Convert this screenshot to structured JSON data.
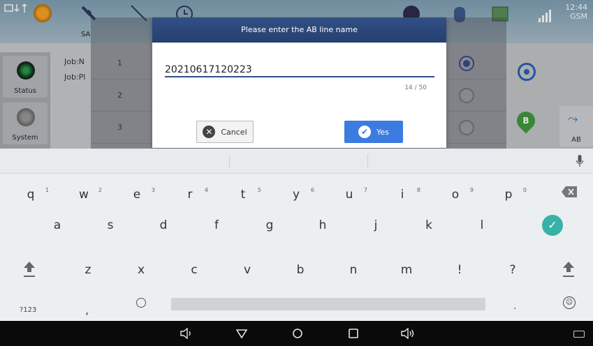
{
  "app": {
    "sat_label": "SA",
    "clock": "12:44",
    "network": "GSM",
    "rail": [
      {
        "label": "Status"
      },
      {
        "label": "System"
      }
    ],
    "job_lines": [
      "Job:N",
      "Job:Pl"
    ],
    "list_rows": [
      {
        "num": "1",
        "selected": true
      },
      {
        "num": "2",
        "selected": false
      },
      {
        "num": "3",
        "selected": false
      }
    ],
    "ab_label": "AB",
    "b_marker": "B"
  },
  "dialog": {
    "title": "Please enter the AB line name",
    "input_value": "20210617120223",
    "char_count": "14 / 50",
    "cancel_label": "Cancel",
    "yes_label": "Yes"
  },
  "keyboard": {
    "row1": [
      {
        "ch": "q",
        "hint": "1"
      },
      {
        "ch": "w",
        "hint": "2"
      },
      {
        "ch": "e",
        "hint": "3"
      },
      {
        "ch": "r",
        "hint": "4"
      },
      {
        "ch": "t",
        "hint": "5"
      },
      {
        "ch": "y",
        "hint": "6"
      },
      {
        "ch": "u",
        "hint": "7"
      },
      {
        "ch": "i",
        "hint": "8"
      },
      {
        "ch": "o",
        "hint": "9"
      },
      {
        "ch": "p",
        "hint": "0"
      }
    ],
    "row2": [
      "a",
      "s",
      "d",
      "f",
      "g",
      "h",
      "j",
      "k",
      "l"
    ],
    "row3": [
      "z",
      "x",
      "c",
      "v",
      "b",
      "n",
      "m",
      "!",
      "?"
    ],
    "sym_label": "?123",
    "comma": ",",
    "period": "."
  }
}
